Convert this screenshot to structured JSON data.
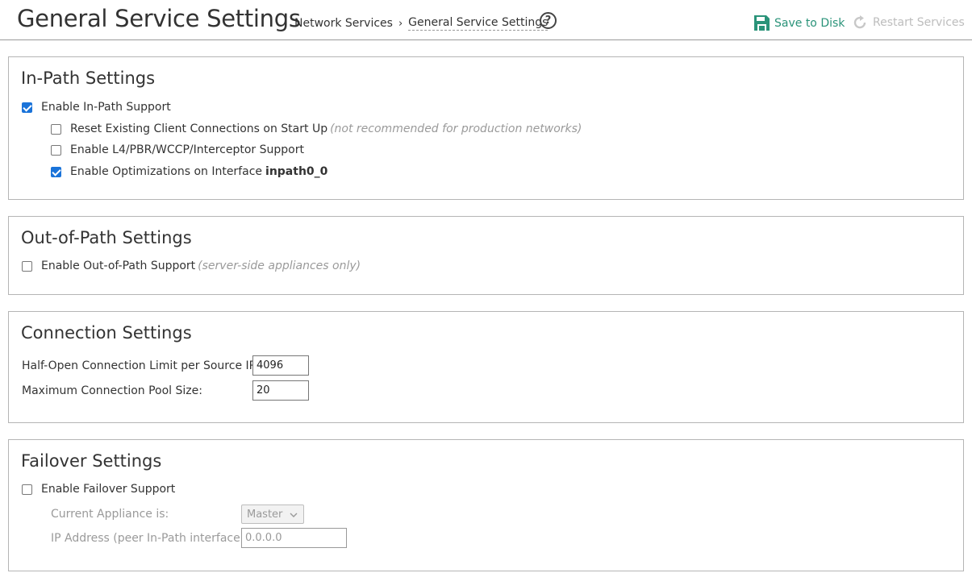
{
  "header": {
    "title": "General Service Settings",
    "breadcrumb": [
      "Network Services",
      "General Service Settings"
    ],
    "breadcrumb_sep": "›",
    "help_glyph": "?",
    "save_label": "Save to Disk",
    "restart_label": "Restart Services",
    "save_color": "#2a9379"
  },
  "in_path": {
    "title": "In-Path Settings",
    "enable": {
      "label": "Enable In-Path Support",
      "checked": true
    },
    "reset": {
      "label": "Reset Existing Client Connections on Start Up",
      "note": "(not recommended for production networks)",
      "checked": false
    },
    "l4": {
      "label": "Enable L4/PBR/WCCP/Interceptor Support",
      "checked": false
    },
    "optim": {
      "label": "Enable Optimizations on Interface",
      "iface": "inpath0_0",
      "checked": true
    }
  },
  "out_of_path": {
    "title": "Out-of-Path Settings",
    "enable": {
      "label": "Enable Out-of-Path Support",
      "note": "(server-side appliances only)",
      "checked": false
    }
  },
  "connection": {
    "title": "Connection Settings",
    "half_open_label": "Half-Open Connection Limit per Source IP:",
    "half_open_value": "4096",
    "pool_label": "Maximum Connection Pool Size:",
    "pool_value": "20"
  },
  "failover": {
    "title": "Failover Settings",
    "enable": {
      "label": "Enable Failover Support",
      "checked": false
    },
    "appliance_label": "Current Appliance is:",
    "appliance_value": "Master",
    "ip_label": "IP Address (peer In-Path interface):",
    "ip_value": "0.0.0.0"
  }
}
